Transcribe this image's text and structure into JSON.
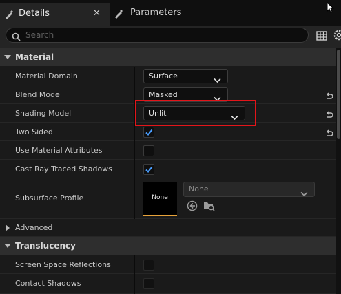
{
  "tabs": [
    {
      "label": "Details",
      "close": "✕",
      "icon": "details-icon"
    },
    {
      "label": "Parameters",
      "icon": "parameters-icon"
    }
  ],
  "search": {
    "placeholder": "Search"
  },
  "toolbar_icons": [
    "table-icon",
    "settings-gear-icon"
  ],
  "categories": {
    "material": "Material",
    "advanced": "Advanced",
    "translucency": "Translucency"
  },
  "material": {
    "material_domain": {
      "label": "Material Domain",
      "value": "Surface"
    },
    "blend_mode": {
      "label": "Blend Mode",
      "value": "Masked"
    },
    "shading_model": {
      "label": "Shading Model",
      "value": "Unlit"
    },
    "two_sided": {
      "label": "Two Sided",
      "checked": true
    },
    "use_material_attributes": {
      "label": "Use Material Attributes",
      "checked": false
    },
    "cast_ray_traced_shadows": {
      "label": "Cast Ray Traced Shadows",
      "checked": true
    },
    "subsurface_profile": {
      "label": "Subsurface Profile",
      "thumbnail": "None",
      "value": "None"
    }
  },
  "translucency": {
    "screen_space_reflections": {
      "label": "Screen Space Reflections",
      "checked": false
    },
    "contact_shadows": {
      "label": "Contact Shadows",
      "checked": false
    }
  },
  "colors": {
    "accent_check": "#4a9eff",
    "highlight": "#e3151a",
    "thumb_underline": "#e8a33a"
  }
}
